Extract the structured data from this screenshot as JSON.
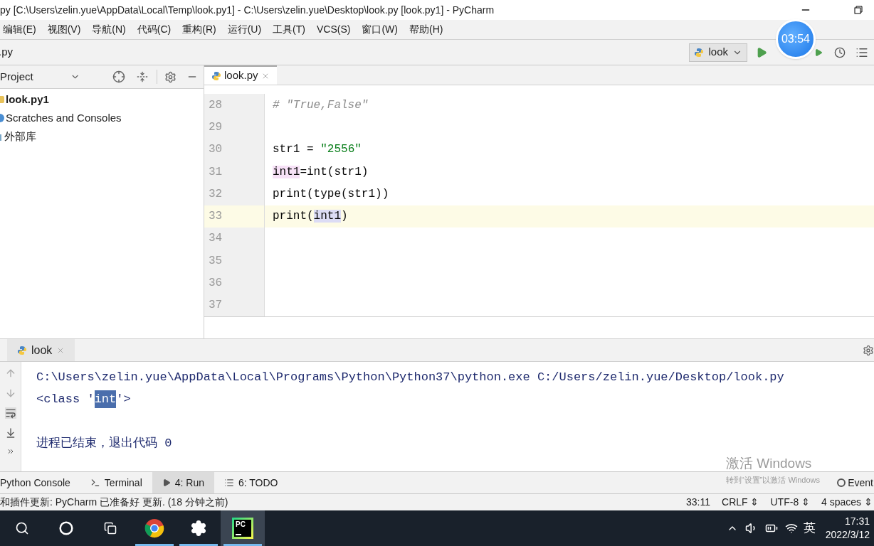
{
  "window": {
    "title": "py [C:\\Users\\zelin.yue\\AppData\\Local\\Temp\\look.py1] - C:\\Users\\zelin.yue\\Desktop\\look.py [look.py1] - PyCharm"
  },
  "menu": [
    "编辑(E)",
    "视图(V)",
    "导航(N)",
    "代码(C)",
    "重构(R)",
    "运行(U)",
    "工具(T)",
    "VCS(S)",
    "窗口(W)",
    "帮助(H)"
  ],
  "breadcrumb": ".py",
  "run_config": "look",
  "timer": "03:54",
  "project": {
    "title": "Project",
    "items": [
      {
        "label": "look.py1",
        "kind": "folder",
        "bold": true
      },
      {
        "label": "Scratches and Consoles",
        "kind": "scratch",
        "bold": false
      },
      {
        "label": "外部库",
        "kind": "library",
        "bold": false
      }
    ]
  },
  "editor_tabs": [
    {
      "label": "look.py",
      "selected": true
    }
  ],
  "code": [
    {
      "number": "28",
      "current": false,
      "segments": [
        {
          "text": "# ″True,False″",
          "kind": "comment"
        }
      ]
    },
    {
      "number": "29",
      "current": false
    },
    {
      "number": "30",
      "current": false,
      "segments": [
        {
          "text": "str1 = ",
          "kind": "plain"
        },
        {
          "text": "″2556″",
          "kind": "string"
        }
      ]
    },
    {
      "number": "31",
      "current": false,
      "segments": [
        {
          "text": "int1",
          "kind": "warning"
        },
        {
          "text": "=int(str1)",
          "kind": "plain"
        }
      ]
    },
    {
      "number": "32",
      "current": false,
      "segments": [
        {
          "text": "print(type(str1))",
          "kind": "plain"
        }
      ]
    },
    {
      "number": "33",
      "current": true,
      "segments": [
        {
          "text": "print(",
          "kind": "plain"
        },
        {
          "text": "int1",
          "kind": "usage"
        },
        {
          "text": ")",
          "kind": "plain"
        }
      ]
    },
    {
      "number": "34",
      "current": false
    },
    {
      "number": "35",
      "current": false
    },
    {
      "number": "36",
      "current": false
    },
    {
      "number": "37",
      "current": false
    }
  ],
  "run_panel": {
    "tab": "look",
    "output": [
      {
        "segments": [
          {
            "text": "C:\\Users\\zelin.yue\\AppData\\Local\\Programs\\Python\\Python37\\python.exe C:/Users/zelin.yue/Desktop/look.py",
            "kind": "plain"
          }
        ]
      },
      {
        "segments": [
          {
            "text": "<class '",
            "kind": "plain"
          },
          {
            "text": "int",
            "kind": "selected"
          },
          {
            "text": "'>",
            "kind": "plain"
          }
        ]
      },
      {
        "blank_before": true,
        "segments": [
          {
            "text": "进程已结束，退出代码 0",
            "kind": "plain"
          }
        ]
      }
    ]
  },
  "tool_tabs": [
    {
      "label": "Python Console",
      "kind": "python",
      "selected": false
    },
    {
      "label": "Terminal",
      "kind": "terminal",
      "selected": false
    },
    {
      "label": "4: Run",
      "kind": "run",
      "selected": true
    },
    {
      "label": "6: TODO",
      "kind": "todo",
      "selected": false
    }
  ],
  "event_log": "Event",
  "activation": {
    "title": "激活 Windows",
    "hint": "转到“设置”以激活 Windows"
  },
  "status_bar": {
    "message": "和插件更新: PyCharm 已准备好 更新. (18 分钟之前)",
    "position": "33:11",
    "line_sep": "CRLF",
    "encoding": "UTF-8",
    "indent": "4 spaces",
    "picker": "⇕"
  },
  "taskbar": {
    "apps": [
      {
        "kind": "search",
        "running": false
      },
      {
        "kind": "cortana",
        "running": false
      },
      {
        "kind": "taskview",
        "running": false
      },
      {
        "kind": "chrome",
        "running": true
      },
      {
        "kind": "settings",
        "running": true
      },
      {
        "kind": "pycharm",
        "running": true,
        "label": "PC"
      }
    ],
    "ime": "英",
    "time": "17:31",
    "date": "2022/3/12"
  }
}
